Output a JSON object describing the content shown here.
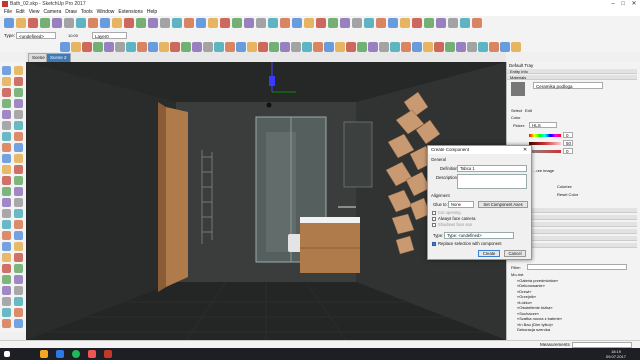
{
  "window": {
    "title": "Bath_02.skp - SketchUp Pro 2017"
  },
  "menu": [
    "File",
    "Edit",
    "View",
    "Camera",
    "Draw",
    "Tools",
    "Window",
    "Extensions",
    "Help"
  ],
  "layers": {
    "type_label": "Type:",
    "type_value": "<undefined>",
    "layer_value": "Layer0",
    "num1": "10:00",
    "num2": "00:00 AM"
  },
  "scenes": [
    "Scene 1",
    "Scene 2"
  ],
  "tray": {
    "title": "Default Tray",
    "entity_info": "Entity Info",
    "materials": "Materials",
    "material_name": "Ceramika podloga",
    "tabs": [
      "Select",
      "Edit"
    ],
    "color_label": "Color",
    "picker_label": "Picker:",
    "picker_value": "HLS",
    "h_val": "0",
    "l_val": "50",
    "s_val": "0",
    "texture_label": "...ure image",
    "colorize": "Colorize",
    "reset_color": "Reset Color",
    "filter_label": "Filter:",
    "tree_root": "Mo-ńst",
    "tree_items": [
      "«Galeria przedmiotów»",
      "«Dekorowanie»",
      "«Drzwi»",
      "«Grzejnik»",
      "«Łóżko»",
      "«Oświetlenie łóżka»",
      "«Suchacze»",
      "«Szafka nocna z baterie»",
      "«In Bau (Dim tylko)»",
      "Dekoracja szeroka"
    ],
    "measurements_label": "Measurements"
  },
  "dialog": {
    "title": "Create Component",
    "general": "General",
    "definition_label": "Definition:",
    "definition_value": "Tabca 1",
    "description_label": "Description:",
    "alignment": "Alignment",
    "glue_label": "Glue to:",
    "glue_value": "None",
    "set_axes": "Set Component Axes",
    "cut_opening": "Cut opening",
    "always_face": "Always face camera",
    "shadows_face": "Shadows face sun",
    "type_label": "Type:",
    "type_value": "Type: <undefined>",
    "replace": "Replace selection with component",
    "create": "Create",
    "cancel": "Cancel"
  },
  "taskbar": {
    "time": "18:19",
    "date": "09.07.2017"
  }
}
